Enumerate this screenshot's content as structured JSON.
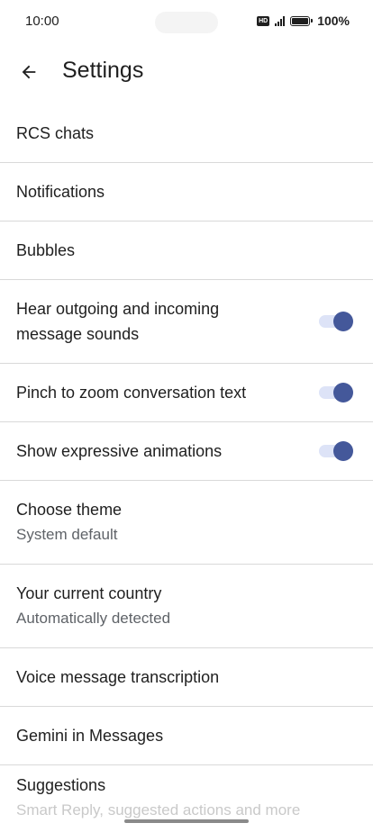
{
  "status_bar": {
    "time": "10:00",
    "hd_label": "HD",
    "battery_percent": "100%",
    "icons": [
      "hd-icon",
      "signal-icon",
      "battery-icon"
    ]
  },
  "app_bar": {
    "back_icon": "arrow-back-icon",
    "title": "Settings"
  },
  "settings": {
    "rcs_chats": {
      "title": "RCS chats"
    },
    "notifications": {
      "title": "Notifications"
    },
    "bubbles": {
      "title": "Bubbles"
    },
    "message_sounds": {
      "title": "Hear outgoing and incoming message sounds",
      "enabled": true
    },
    "pinch_zoom": {
      "title": "Pinch to zoom conversation text",
      "enabled": true
    },
    "expressive_animations": {
      "title": "Show expressive animations",
      "enabled": true
    },
    "choose_theme": {
      "title": "Choose theme",
      "subtitle": "System default"
    },
    "current_country": {
      "title": "Your current country",
      "subtitle": "Automatically detected"
    },
    "voice_transcription": {
      "title": "Voice message transcription"
    },
    "gemini": {
      "title": "Gemini in Messages"
    },
    "suggestions": {
      "title": "Suggestions",
      "subtitle": "Smart Reply, suggested actions and more"
    }
  },
  "colors": {
    "toggle_thumb": "#44589a",
    "toggle_track": "#dde3f7",
    "divider": "#d9d9d9",
    "text_primary": "#1f1f1f",
    "text_secondary": "#5f6368"
  }
}
